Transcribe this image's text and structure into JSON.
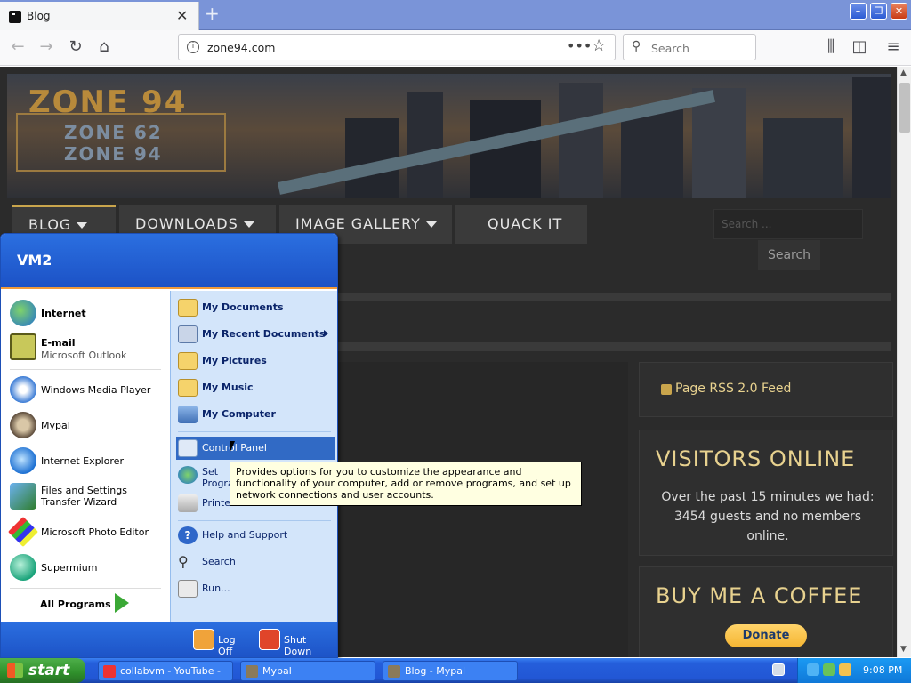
{
  "browser": {
    "tab_title": "Blog",
    "url": "zone94.com",
    "search_placeholder": "Search",
    "page_actions": "•••"
  },
  "site": {
    "logo_main": "ZONE 94",
    "logo_sub1": "ZONE 62",
    "logo_sub2": "ZONE 94",
    "menu": [
      "BLOG",
      "DOWNLOADS",
      "IMAGE GALLERY",
      "QUACK IT"
    ],
    "search_placeholder": "Search ...",
    "search_button": "Search",
    "rss_link": "Page RSS 2.0 Feed",
    "visitors_title": "VISITORS ONLINE",
    "visitors_text": "Over the past 15 minutes we had: 3454 guests and no members online.",
    "coffee_title": "BUY ME A COFFEE",
    "donate_label": "Donate"
  },
  "start_menu": {
    "user": "VM2",
    "pinned": [
      {
        "label": "Internet",
        "sub": ""
      },
      {
        "label": "E-mail",
        "sub": "Microsoft Outlook"
      }
    ],
    "recent": [
      "Windows Media Player",
      "Mypal",
      "Internet Explorer",
      "Files and Settings Transfer Wizard",
      "Microsoft Photo Editor",
      "Supermium"
    ],
    "all_programs": "All Programs",
    "right_items": [
      "My Documents",
      "My Recent Documents",
      "My Pictures",
      "My Music",
      "My Computer",
      "Control Panel",
      "Set Program Access and Defaults",
      "Printers and Faxes",
      "Help and Support",
      "Search",
      "Run..."
    ],
    "log_off": "Log Off",
    "shut_down": "Shut Down",
    "tooltip": "Provides options for you to customize the appearance and functionality of your computer, add or remove programs, and set up network connections and user accounts."
  },
  "taskbar": {
    "start": "start",
    "tasks": [
      "collabvm - YouTube - ...",
      "Mypal",
      "Blog - Mypal"
    ],
    "clock": "9:08 PM"
  }
}
